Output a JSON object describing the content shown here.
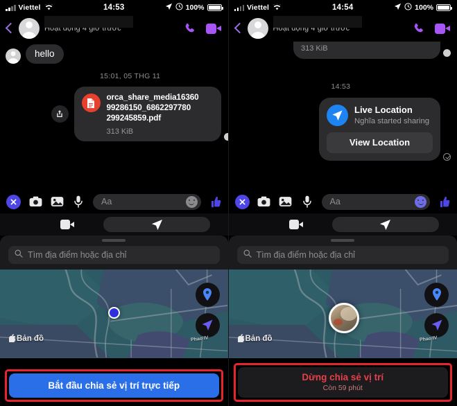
{
  "left": {
    "status_bar": {
      "carrier": "Viettel",
      "time": "14:53",
      "battery_pct": "100%",
      "wifi_icon": "wifi-icon",
      "location_icon": "location-arrow-icon",
      "alarm_icon": "alarm-icon"
    },
    "header": {
      "back_icon": "back-chevron-icon",
      "avatar": "contact-avatar",
      "name_redacted": "",
      "status": "Hoạt động 4 giờ trước",
      "call_icon": "phone-icon",
      "video_icon": "video-camera-icon"
    },
    "thread": {
      "incoming_message": "hello",
      "timestamp": "15:01, 05 THG 11",
      "file": {
        "name": "orca_share_media163609928615 0_6862297780299245859.pdf",
        "name_line1": "orca_share_media16360",
        "name_line2": "99286150_6862297780",
        "name_line3": "299245859.pdf",
        "size": "313 KiB",
        "icon": "pdf-document-icon",
        "share_icon": "share-upload-icon"
      }
    },
    "composer": {
      "close_label": "✕",
      "camera_icon": "camera-icon",
      "gallery_icon": "photo-gallery-icon",
      "mic_icon": "microphone-icon",
      "input_placeholder": "Aa",
      "emoji_icon": "emoji-smiley-icon",
      "like_icon": "thumbs-up-icon"
    },
    "tray": {
      "video_icon": "add-video-icon",
      "send_icon": "send-location-arrow-icon"
    },
    "sheet": {
      "search_placeholder": "Tìm địa điểm hoặc địa chỉ",
      "search_icon": "search-icon"
    },
    "map": {
      "credit": "Bản đồ",
      "apple_logo": "apple-logo-icon",
      "street_label": "Phao IV",
      "pin_icon": "map-pin-icon",
      "compass_icon": "navigation-arrow-icon",
      "marker_type": "blue-dot"
    },
    "cta": {
      "label": "Bắt đầu chia sẻ vị trí trực tiếp",
      "sub": "",
      "highlight_color": "#e8242e",
      "bg_color": "#2b6fe8"
    }
  },
  "right": {
    "status_bar": {
      "carrier": "Viettel",
      "time": "14:54",
      "battery_pct": "100%",
      "wifi_icon": "wifi-icon",
      "location_icon": "location-arrow-icon",
      "alarm_icon": "alarm-icon"
    },
    "header": {
      "back_icon": "back-chevron-icon",
      "avatar": "contact-avatar",
      "name_redacted": "",
      "status": "Hoạt động 4 giờ trước",
      "call_icon": "phone-icon",
      "video_icon": "video-camera-icon"
    },
    "thread": {
      "clipped_file_size": "313 KiB",
      "timestamp": "14:53",
      "live_location": {
        "title": "Live Location",
        "subtitle": "Nghĩa started sharing",
        "button_label": "View Location",
        "icon": "live-location-arrow-icon",
        "delivered_icon": "delivered-check-icon"
      }
    },
    "composer": {
      "close_label": "✕",
      "camera_icon": "camera-icon",
      "gallery_icon": "photo-gallery-icon",
      "mic_icon": "microphone-icon",
      "input_placeholder": "Aa",
      "emoji_icon": "emoji-smiley-icon",
      "like_icon": "thumbs-up-icon"
    },
    "tray": {
      "video_icon": "add-video-icon",
      "send_icon": "send-location-arrow-icon"
    },
    "sheet": {
      "search_placeholder": "Tìm địa điểm hoặc địa chỉ",
      "search_icon": "search-icon"
    },
    "map": {
      "credit": "Bản đồ",
      "apple_logo": "apple-logo-icon",
      "street_label": "Phao IV",
      "pin_icon": "map-pin-icon",
      "compass_icon": "navigation-arrow-icon",
      "marker_type": "user-photo-avatar"
    },
    "cta": {
      "label": "Dừng chia sẻ vị trí",
      "sub": "Còn 59 phút",
      "highlight_color": "#e8242e",
      "bg_color": "#1c1c1e"
    }
  }
}
